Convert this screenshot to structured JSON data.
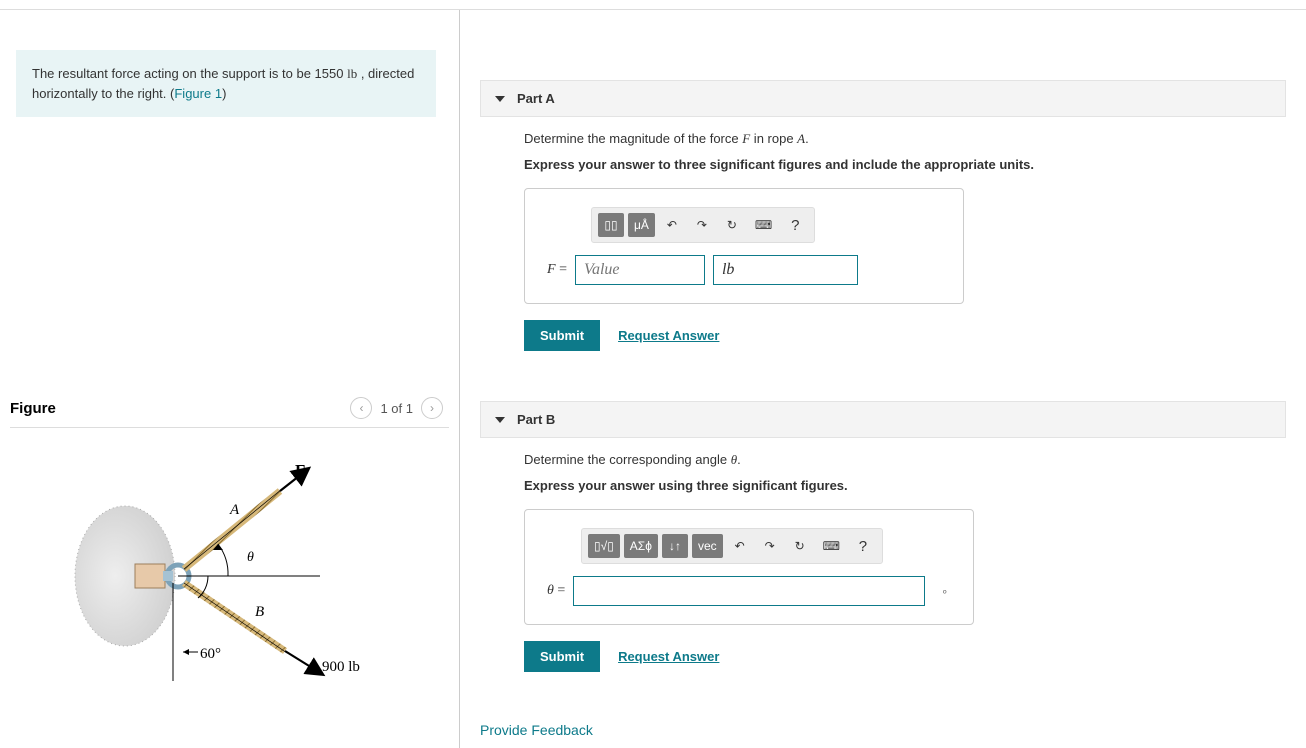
{
  "problem": {
    "text_before": "The resultant force acting on the support is to be 1550 ",
    "unit": "lb",
    "text_after": " , directed horizontally to the right. (",
    "figure_link": "Figure 1",
    "text_close": ")"
  },
  "figure": {
    "title": "Figure",
    "pager": "1 of 1",
    "labels": {
      "F": "F",
      "A": "A",
      "B": "B",
      "theta": "θ",
      "angle60": "60°",
      "force900": "900 lb"
    }
  },
  "partA": {
    "header": "Part A",
    "desc_before": "Determine the magnitude of the force ",
    "desc_F": "F",
    "desc_mid": " in rope ",
    "desc_A": "A",
    "desc_after": ".",
    "instruction": "Express your answer to three significant figures and include the appropriate units.",
    "toolbar": {
      "templates": "▯▯",
      "units": "μÅ",
      "undo": "↶",
      "redo": "↷",
      "reset": "↻",
      "keyboard": "⌨",
      "help": "?"
    },
    "var": "F",
    "eq": "=",
    "value_placeholder": "Value",
    "unit_value": "lb",
    "submit": "Submit",
    "request": "Request Answer"
  },
  "partB": {
    "header": "Part B",
    "desc_before": "Determine the corresponding angle ",
    "desc_theta": "θ",
    "desc_after": ".",
    "instruction": "Express your answer using three significant figures.",
    "toolbar": {
      "templates": "▯√▯",
      "greek": "ΑΣϕ",
      "subsup": "↓↑",
      "vec": "vec",
      "undo": "↶",
      "redo": "↷",
      "reset": "↻",
      "keyboard": "⌨",
      "help": "?"
    },
    "var": "θ",
    "eq": "=",
    "deg": "∘",
    "submit": "Submit",
    "request": "Request Answer"
  },
  "feedback": "Provide Feedback"
}
